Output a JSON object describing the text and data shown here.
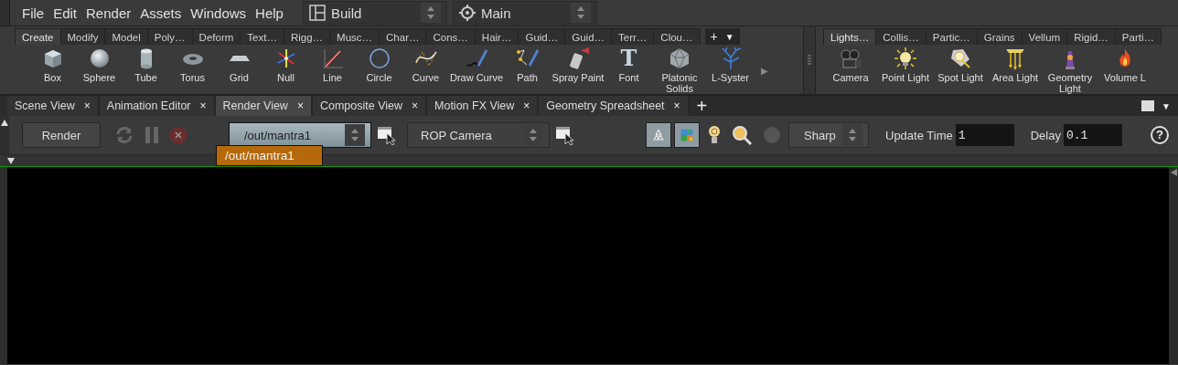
{
  "menu_bar": {
    "items": [
      "File",
      "Edit",
      "Render",
      "Assets",
      "Windows",
      "Help"
    ],
    "desktop": {
      "value": "Build"
    },
    "context": {
      "value": "Main"
    }
  },
  "shelf_left": {
    "tabs": [
      {
        "label": "Create",
        "selected": true
      },
      {
        "label": "Modify",
        "selected": false
      },
      {
        "label": "Model",
        "selected": false
      },
      {
        "label": "Poly…",
        "selected": false
      },
      {
        "label": "Deform",
        "selected": false
      },
      {
        "label": "Text…",
        "selected": false
      },
      {
        "label": "Rigg…",
        "selected": false
      },
      {
        "label": "Musc…",
        "selected": false
      },
      {
        "label": "Char…",
        "selected": false
      },
      {
        "label": "Cons…",
        "selected": false
      },
      {
        "label": "Hair…",
        "selected": false
      },
      {
        "label": "Guid…",
        "selected": false
      },
      {
        "label": "Guid…",
        "selected": false
      },
      {
        "label": "Terr…",
        "selected": false
      },
      {
        "label": "Clou…",
        "selected": false
      }
    ],
    "controls": [
      "+",
      "▼"
    ],
    "tools": [
      {
        "label": "Box"
      },
      {
        "label": "Sphere"
      },
      {
        "label": "Tube"
      },
      {
        "label": "Torus"
      },
      {
        "label": "Grid"
      },
      {
        "label": "Null"
      },
      {
        "label": "Line"
      },
      {
        "label": "Circle"
      },
      {
        "label": "Curve"
      },
      {
        "label": "Draw Curve"
      },
      {
        "label": "Path"
      },
      {
        "label": "Spray Paint"
      },
      {
        "label": "Font",
        "glyph": "T"
      },
      {
        "label": "Platonic Solids"
      },
      {
        "label": "L-Syster"
      }
    ],
    "more_arrow": "▶"
  },
  "shelf_right": {
    "tabs": [
      {
        "label": "Lights…",
        "selected": true
      },
      {
        "label": "Collis…",
        "selected": false
      },
      {
        "label": "Partic…",
        "selected": false
      },
      {
        "label": "Grains",
        "selected": false
      },
      {
        "label": "Vellum",
        "selected": false
      },
      {
        "label": "Rigid…",
        "selected": false
      },
      {
        "label": "Parti…",
        "selected": false
      }
    ],
    "tools": [
      {
        "label": "Camera"
      },
      {
        "label": "Point Light"
      },
      {
        "label": "Spot Light"
      },
      {
        "label": "Area Light"
      },
      {
        "label": "Geometry Light"
      },
      {
        "label": "Volume L"
      }
    ]
  },
  "pane_tabs": {
    "tabs": [
      {
        "label": "Scene View",
        "close": "×",
        "selected": false
      },
      {
        "label": "Animation Editor",
        "close": "×",
        "selected": false
      },
      {
        "label": "Render View",
        "close": "×",
        "selected": true
      },
      {
        "label": "Composite View",
        "close": "×",
        "selected": false
      },
      {
        "label": "Motion FX View",
        "close": "×",
        "selected": false
      },
      {
        "label": "Geometry Spreadsheet",
        "close": "×",
        "selected": false
      }
    ],
    "add": "+",
    "menu": "▼"
  },
  "render_toolbar": {
    "render_button": "Render",
    "stop_disabled": true,
    "rop_dropdown": {
      "value": "/out/mantra1",
      "open": true
    },
    "rop_popup": [
      {
        "label": "/out/mantra1",
        "selected": true
      }
    ],
    "camera_dropdown": {
      "value": "ROP Camera"
    },
    "toggles": [
      {
        "on": true
      },
      {
        "on": true
      }
    ],
    "preview_dropdown": {
      "value": "Sharp"
    },
    "update_time": {
      "label": "Update Time",
      "value": "1"
    },
    "delay": {
      "label": "Delay",
      "value": "0.1"
    },
    "help": "?"
  }
}
